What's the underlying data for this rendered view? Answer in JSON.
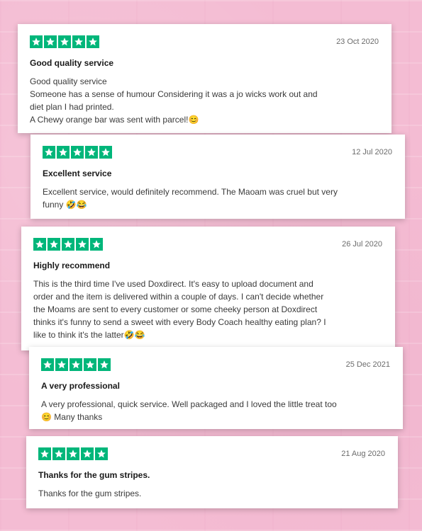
{
  "colors": {
    "star_green": "#00b67a",
    "background_pink": "#f4bcd3"
  },
  "reviews": [
    {
      "rating": 5,
      "date": "23 Oct 2020",
      "title": "Good quality service",
      "lines": [
        "Good quality service",
        "Someone has a sense of humour Considering it was a jo wicks work out and",
        "diet plan I had printed.",
        "A Chewy orange bar was sent with parcel!😊"
      ]
    },
    {
      "rating": 5,
      "date": "12 Jul 2020",
      "title": "Excellent service",
      "lines": [
        "Excellent service, would definitely recommend. The Maoam was cruel but very",
        "funny 🤣😂"
      ]
    },
    {
      "rating": 5,
      "date": "26 Jul 2020",
      "title": "Highly recommend",
      "lines": [
        "This is the third time I've used Doxdirect. It's easy to upload document and",
        "order and the item is delivered within a couple of days. I can't decide whether",
        "the Moams are sent to every customer or some cheeky person at Doxdirect",
        "thinks it's funny to send a sweet with every Body Coach healthy eating plan? I",
        "like to think it's the latter🤣😂"
      ]
    },
    {
      "rating": 5,
      "date": "25 Dec 2021",
      "title": "A very professional",
      "lines": [
        "A very professional, quick service. Well packaged and I loved the little treat too",
        "😊 Many thanks"
      ]
    },
    {
      "rating": 5,
      "date": "21 Aug 2020",
      "title": "Thanks for the gum stripes.",
      "lines": [
        "Thanks for the gum stripes."
      ]
    }
  ]
}
